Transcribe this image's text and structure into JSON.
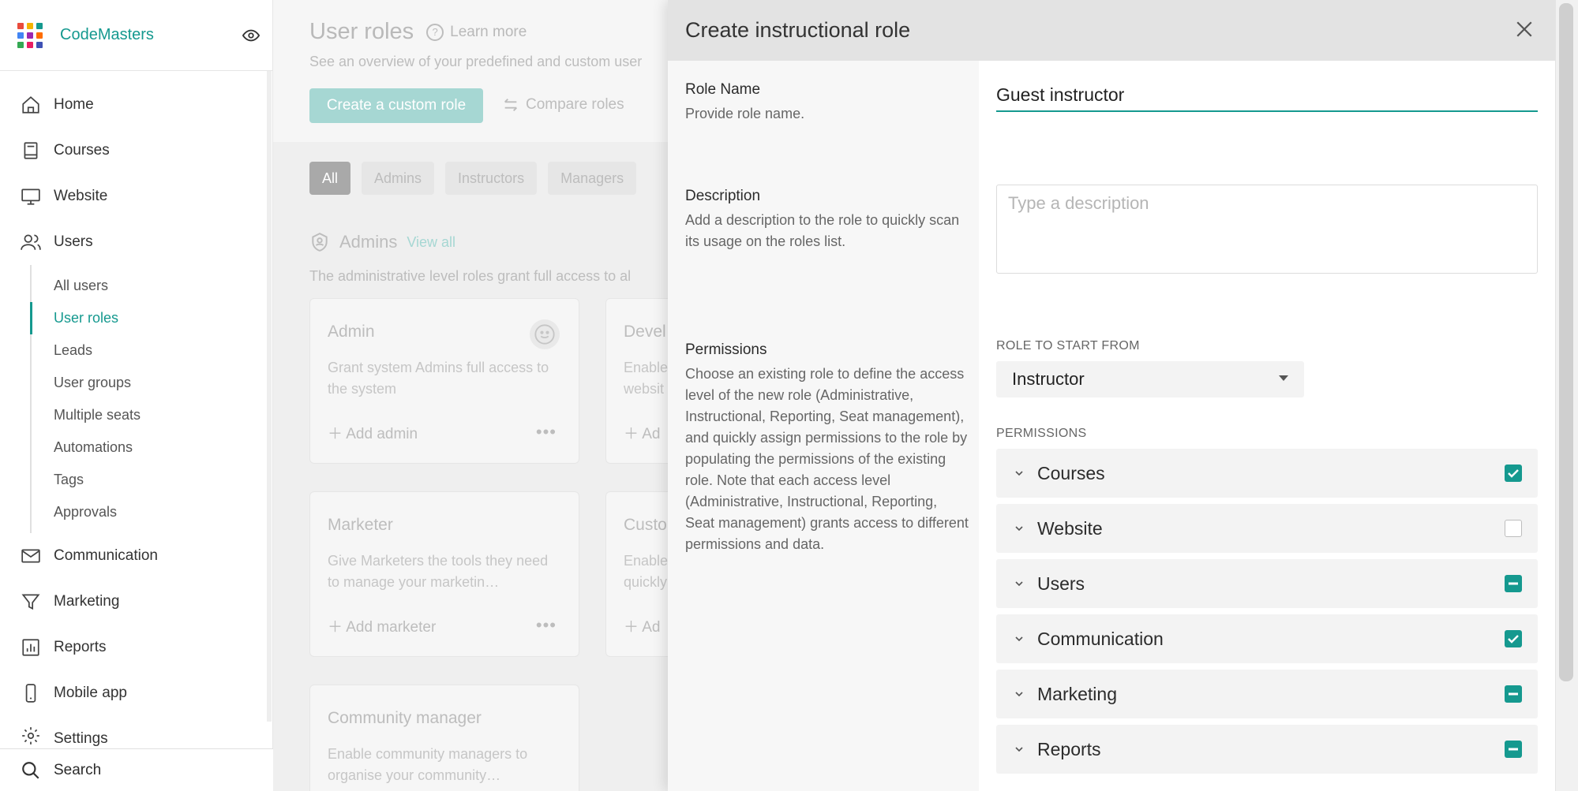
{
  "brand": {
    "name": "CodeMasters",
    "logo_colors": [
      "#e94b3c",
      "#f4b400",
      "#15998f",
      "#4285f4",
      "#9c27b0",
      "#ff6d00",
      "#34a853",
      "#e91e63",
      "#3f51b5"
    ]
  },
  "sidebar": {
    "items_top": [
      {
        "label": "Home",
        "icon": "home-icon"
      },
      {
        "label": "Courses",
        "icon": "book-icon"
      },
      {
        "label": "Website",
        "icon": "monitor-icon"
      },
      {
        "label": "Users",
        "icon": "users-icon"
      }
    ],
    "sub_items": [
      {
        "label": "All users"
      },
      {
        "label": "User roles",
        "active": true
      },
      {
        "label": "Leads"
      },
      {
        "label": "User groups"
      },
      {
        "label": "Multiple seats"
      },
      {
        "label": "Automations"
      },
      {
        "label": "Tags"
      },
      {
        "label": "Approvals"
      }
    ],
    "items_bottom": [
      {
        "label": "Communication",
        "icon": "mail-icon"
      },
      {
        "label": "Marketing",
        "icon": "funnel-icon"
      },
      {
        "label": "Reports",
        "icon": "chart-icon"
      },
      {
        "label": "Mobile app",
        "icon": "phone-icon"
      },
      {
        "label": "Settings",
        "icon": "gear-icon"
      }
    ],
    "search_label": "Search"
  },
  "main": {
    "title": "User roles",
    "learn_more": "Learn more",
    "overview": "See an overview of your predefined and custom user",
    "create_button": "Create a custom role",
    "compare_button": "Compare roles",
    "chips": [
      "All",
      "Admins",
      "Instructors",
      "Managers"
    ],
    "admins_title": "Admins",
    "view_all": "View all",
    "admins_desc": "The administrative level roles grant full access to al",
    "cards": [
      {
        "title": "Admin",
        "desc": "Grant system Admins full access to the system",
        "action": "Add admin"
      },
      {
        "title": "Devel",
        "desc": "Enable websit",
        "action": "Ad"
      },
      {
        "title": "Marketer",
        "desc": "Give Marketers the tools they need to manage your marketin…",
        "action": "Add marketer"
      },
      {
        "title": "Custo",
        "desc": "Enable quickly",
        "action": "Ad"
      },
      {
        "title": "Community manager",
        "desc": "Enable community managers to organise your community…",
        "action": ""
      }
    ]
  },
  "panel": {
    "title": "Create instructional role",
    "role_name_label": "Role Name",
    "role_name_help": "Provide role name.",
    "role_name_value": "Guest instructor",
    "description_label": "Description",
    "description_help": "Add a description to the role to quickly scan its usage on the roles list.",
    "description_placeholder": "Type a description",
    "permissions_label": "Permissions",
    "permissions_help": "Choose an existing role to define the access level of the new role (Administrative, Instructional, Reporting, Seat management), and quickly assign permissions to the role by populating the permissions of the existing role. Note that each access level (Administrative, Instructional, Reporting, Seat management) grants access to different permissions and data.",
    "role_start_caption": "ROLE TO START FROM",
    "role_start_value": "Instructor",
    "permissions_caption": "PERMISSIONS",
    "permissions": [
      {
        "name": "Courses",
        "state": "checked"
      },
      {
        "name": "Website",
        "state": "empty"
      },
      {
        "name": "Users",
        "state": "partial"
      },
      {
        "name": "Communication",
        "state": "checked"
      },
      {
        "name": "Marketing",
        "state": "partial"
      },
      {
        "name": "Reports",
        "state": "partial"
      }
    ]
  },
  "colors": {
    "accent": "#15998f"
  }
}
